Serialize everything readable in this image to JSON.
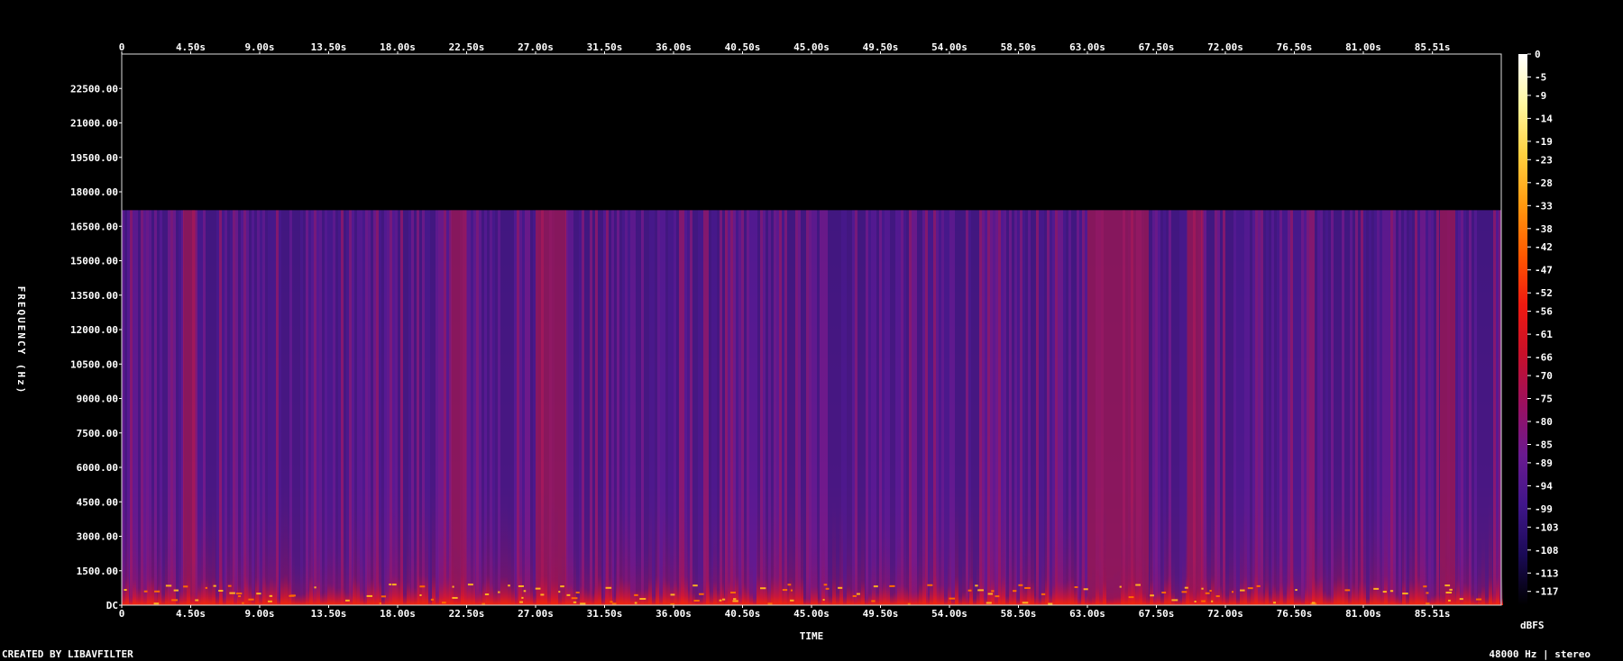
{
  "chart_data": {
    "type": "heatmap",
    "x_axis": {
      "label": "TIME",
      "ticks": [
        "0",
        "4.50s",
        "9.00s",
        "13.50s",
        "18.00s",
        "22.50s",
        "27.00s",
        "31.50s",
        "36.00s",
        "40.50s",
        "45.00s",
        "49.50s",
        "54.00s",
        "58.50s",
        "63.00s",
        "67.50s",
        "72.00s",
        "76.50s",
        "81.00s",
        "85.51s"
      ],
      "range": [
        0,
        90
      ]
    },
    "y_axis": {
      "label": "FREQUENCY (Hz)",
      "ticks": [
        "DC",
        "1500.00",
        "3000.00",
        "4500.00",
        "6000.00",
        "7500.00",
        "9000.00",
        "10500.00",
        "12000.00",
        "13500.00",
        "15000.00",
        "16500.00",
        "18000.00",
        "19500.00",
        "21000.00",
        "22500.00"
      ],
      "range": [
        0,
        24000
      ]
    },
    "colorbar": {
      "label": "dBFS",
      "ticks": [
        "0",
        "-5",
        "-9",
        "-14",
        "-19",
        "-23",
        "-28",
        "-33",
        "-38",
        "-42",
        "-47",
        "-52",
        "-56",
        "-61",
        "-66",
        "-70",
        "-75",
        "-80",
        "-85",
        "-89",
        "-94",
        "-99",
        "-103",
        "-108",
        "-113",
        "-117"
      ],
      "range": [
        0,
        -120
      ],
      "colors": [
        "#ffffff",
        "#fff7a0",
        "#ffd040",
        "#ff9a10",
        "#ff5a00",
        "#f01a10",
        "#c8102a",
        "#9a1060",
        "#6a1a90",
        "#40168a",
        "#1a0a55",
        "#000000"
      ]
    },
    "spectral_cutoff_hz": 17200,
    "loud_time_bands_s": [
      [
        4.0,
        4.8
      ],
      [
        21.5,
        22.5
      ],
      [
        27.0,
        29.0
      ],
      [
        63.0,
        67.0
      ],
      [
        69.5,
        70.5
      ],
      [
        86.0,
        87.0
      ]
    ],
    "footer_left": "CREATED BY LIBAVFILTER",
    "footer_right": "48000 Hz | stereo"
  },
  "colors": {
    "background": "#000000",
    "text": "#ffffff"
  }
}
